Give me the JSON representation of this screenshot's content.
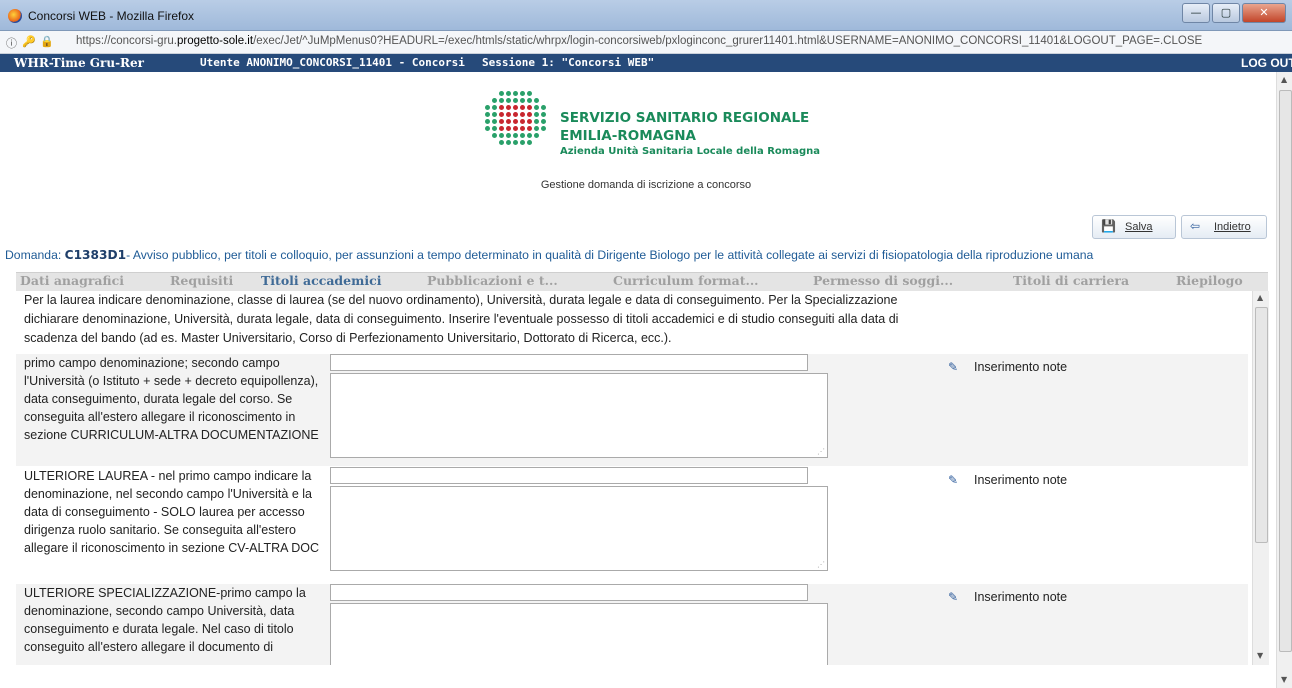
{
  "window": {
    "title": "Concorsi WEB - Mozilla Firefox",
    "buttons": {
      "minimize": "—",
      "maximize": "▢",
      "close": "✕"
    }
  },
  "urlbar": {
    "url_prefix": "https://concorsi-gru.",
    "url_domain": "progetto-sole.it",
    "url_rest": "/exec/Jet/^JuMpMenus0?HEADURL=/exec/htmls/static/whrpx/login-concorsiweb/pxloginconc_grurer11401.html&USERNAME=ANONIMO_CONCORSI_11401&LOGOUT_PAGE=.CLOSE"
  },
  "appbar": {
    "app_name": "WHR-Time Gru-Rer",
    "user": "Utente ANONIMO_CONCORSI_11401 - Concorsi",
    "session_overlap": "Sessione 1: \"Concorsi WEB\"",
    "logout": "LOG OUT"
  },
  "logo": {
    "line1": "SERVIZIO SANITARIO REGIONALE",
    "line2": "EMILIA-ROMAGNA",
    "line3": "Azienda Unità Sanitaria Locale della Romagna"
  },
  "page": {
    "subtitle": "Gestione domanda di iscrizione a concorso"
  },
  "actions": {
    "save": "Salva",
    "back": "Indietro"
  },
  "domanda": {
    "prefix": "Domanda: ",
    "code": "C1383D1",
    "text": "- Avviso pubblico, per titoli e colloquio, per assunzioni a tempo determinato in qualità di Dirigente Biologo per le attività collegate ai servizi di fisiopatologia della riproduzione umana"
  },
  "tabs": [
    {
      "label": "Dati anagrafici",
      "active": false
    },
    {
      "label": "Requisiti",
      "active": false
    },
    {
      "label": "Titoli accademici",
      "active": true
    },
    {
      "label": "Pubblicazioni e t...",
      "active": false
    },
    {
      "label": "Curriculum format...",
      "active": false
    },
    {
      "label": "Permesso di soggi...",
      "active": false
    },
    {
      "label": "Titoli di carriera",
      "active": false
    },
    {
      "label": "Riepilogo",
      "active": false
    }
  ],
  "intro": "Per la laurea indicare denominazione, classe di laurea (se del nuovo ordinamento), Università, durata legale e data di conseguimento. Per la Specializzazione dichiarare denominazione, Università, durata legale, data di conseguimento. Inserire l'eventuale possesso di titoli accademici e di studio conseguiti alla data di scadenza del bando (ad es. Master Universitario, Corso di Perfezionamento Universitario, Dottorato di Ricerca, ecc.).",
  "rows": [
    {
      "label": "primo campo denominazione; secondo campo l'Università (o Istituto + sede + decreto equipollenza), data conseguimento, durata legale del corso. Se conseguita all'estero allegare il riconoscimento in sezione CURRICULUM-ALTRA DOCUMENTAZIONE",
      "field_value": "",
      "textarea_value": "",
      "note_label": "Inserimento note"
    },
    {
      "label": "ULTERIORE LAUREA - nel primo campo indicare la denominazione, nel secondo campo l'Università e la data di conseguimento - SOLO laurea per accesso dirigenza ruolo sanitario. Se conseguita all'estero allegare il riconoscimento in sezione CV-ALTRA DOC",
      "field_value": "",
      "textarea_value": "",
      "note_label": "Inserimento note"
    },
    {
      "label": "ULTERIORE SPECIALIZZAZIONE-primo campo la denominazione, secondo campo Università, data conseguimento e durata legale. Nel caso di titolo conseguito all'estero allegare il documento di",
      "field_value": "",
      "textarea_value": "",
      "note_label": "Inserimento note"
    }
  ],
  "colors": {
    "appbar": "#264a7a",
    "domanda_text": "#1f5b96",
    "active_tab": "#3f6a96",
    "logo_green": "#1a8a5a",
    "logo_red": "#c8272f"
  }
}
